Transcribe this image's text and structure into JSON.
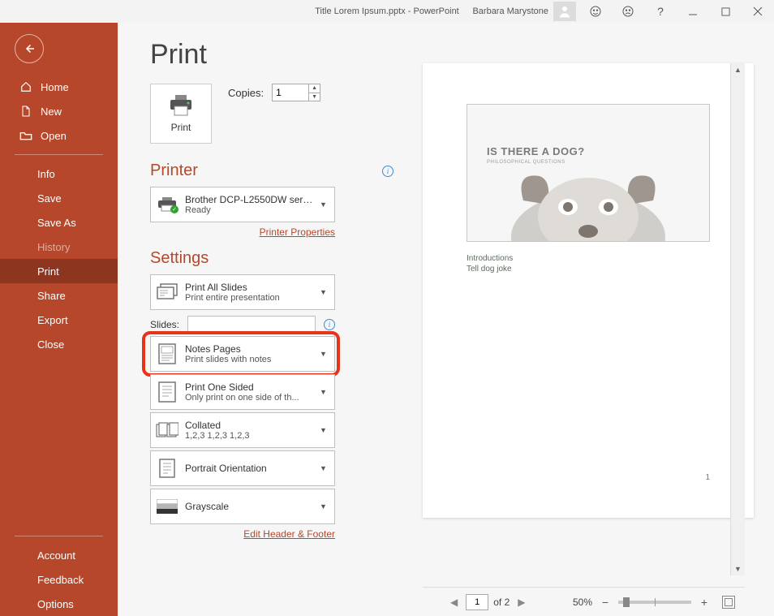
{
  "titlebar": {
    "title": "Title Lorem Ipsum.pptx  -  PowerPoint",
    "username": "Barbara Marystone"
  },
  "sidebar": {
    "home": "Home",
    "new": "New",
    "open": "Open",
    "info": "Info",
    "save": "Save",
    "save_as": "Save As",
    "history": "History",
    "print": "Print",
    "share": "Share",
    "export": "Export",
    "close": "Close",
    "account": "Account",
    "feedback": "Feedback",
    "options": "Options"
  },
  "page": {
    "title": "Print",
    "print_btn": "Print",
    "copies_label": "Copies:",
    "copies_value": "1"
  },
  "printer": {
    "heading": "Printer",
    "name": "Brother DCP-L2550DW serie...",
    "status": "Ready",
    "properties_link": "Printer Properties"
  },
  "settings": {
    "heading": "Settings",
    "print_all": {
      "title": "Print All Slides",
      "sub": "Print entire presentation"
    },
    "slides_label": "Slides:",
    "notes_pages": {
      "title": "Notes Pages",
      "sub": "Print slides with notes"
    },
    "one_sided": {
      "title": "Print One Sided",
      "sub": "Only print on one side of th..."
    },
    "collated": {
      "title": "Collated",
      "sub": "1,2,3    1,2,3    1,2,3"
    },
    "orientation": {
      "title": "Portrait Orientation"
    },
    "color": {
      "title": "Grayscale"
    },
    "edit_link": "Edit Header & Footer"
  },
  "preview": {
    "slide_title": "IS THERE A DOG?",
    "slide_subtitle": "PHILOSOPHICAL  QUESTIONS",
    "notes_line1": "Introductions",
    "notes_line2": "Tell dog joke",
    "page_number": "1"
  },
  "bottombar": {
    "current_page": "1",
    "total_pages": "of 2",
    "zoom_pct": "50%"
  }
}
